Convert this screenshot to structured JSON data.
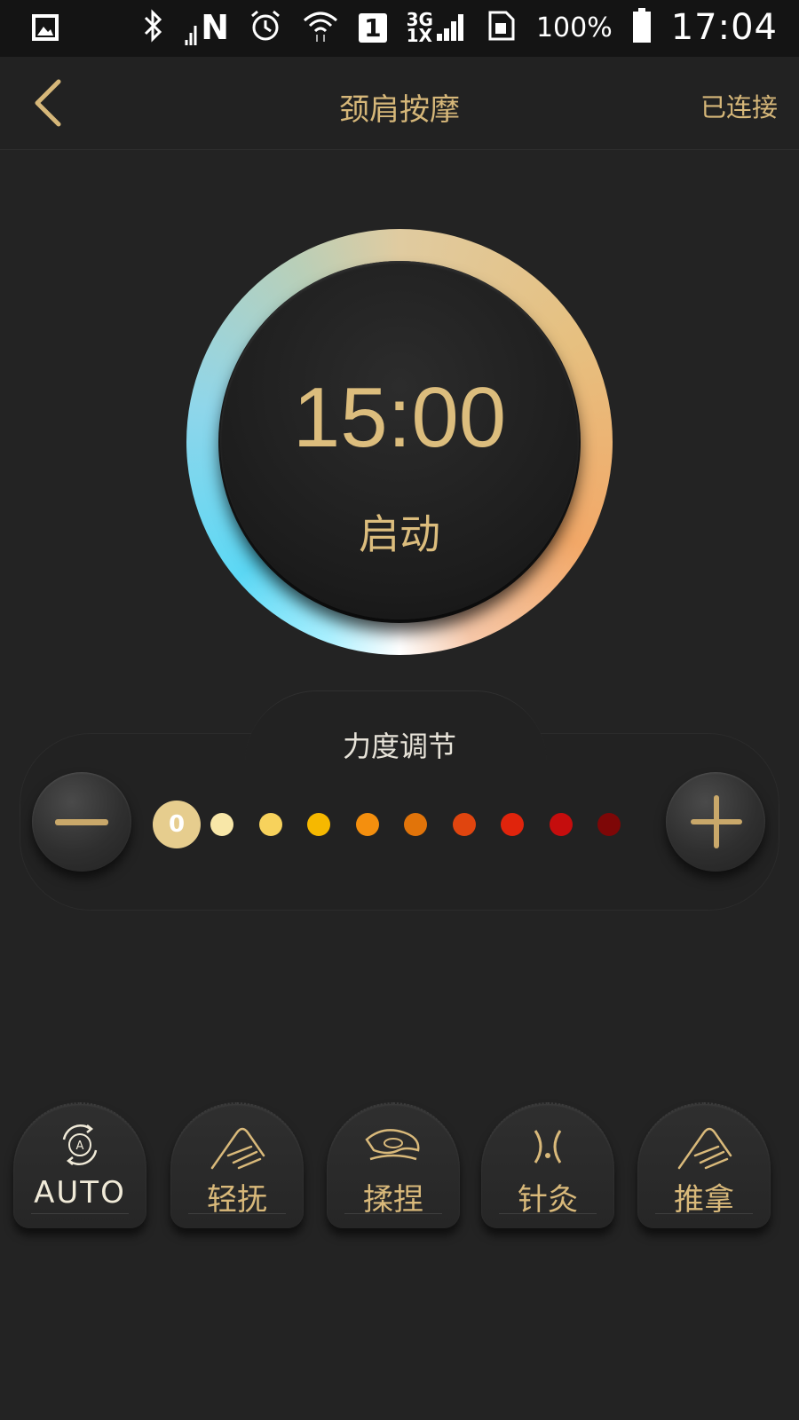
{
  "status_bar": {
    "battery": "100%",
    "time": "17:04",
    "sim_slot": "1",
    "network_top": "3G",
    "network_bottom": "1X",
    "notification_letter": "N"
  },
  "header": {
    "title": "颈肩按摩",
    "connection_status": "已连接"
  },
  "timer": {
    "time": "15:00",
    "start_label": "启动"
  },
  "strength": {
    "label": "力度调节",
    "current_level": "0",
    "level_colors": [
      "#e6cd8e",
      "#f8e7a8",
      "#f7d25c",
      "#f6b800",
      "#f48f0e",
      "#e1740a",
      "#e0450f",
      "#e0240c",
      "#c50d0d",
      "#7e0707"
    ]
  },
  "modes": [
    {
      "label": "AUTO",
      "icon": "auto-cycle-icon"
    },
    {
      "label": "轻抚",
      "icon": "hand-stroke-icon"
    },
    {
      "label": "揉捏",
      "icon": "hand-knead-icon"
    },
    {
      "label": "针灸",
      "icon": "acupuncture-icon"
    },
    {
      "label": "推拿",
      "icon": "hand-push-icon"
    }
  ],
  "colors": {
    "accent_gold": "#d9b97a",
    "background": "#232323"
  }
}
